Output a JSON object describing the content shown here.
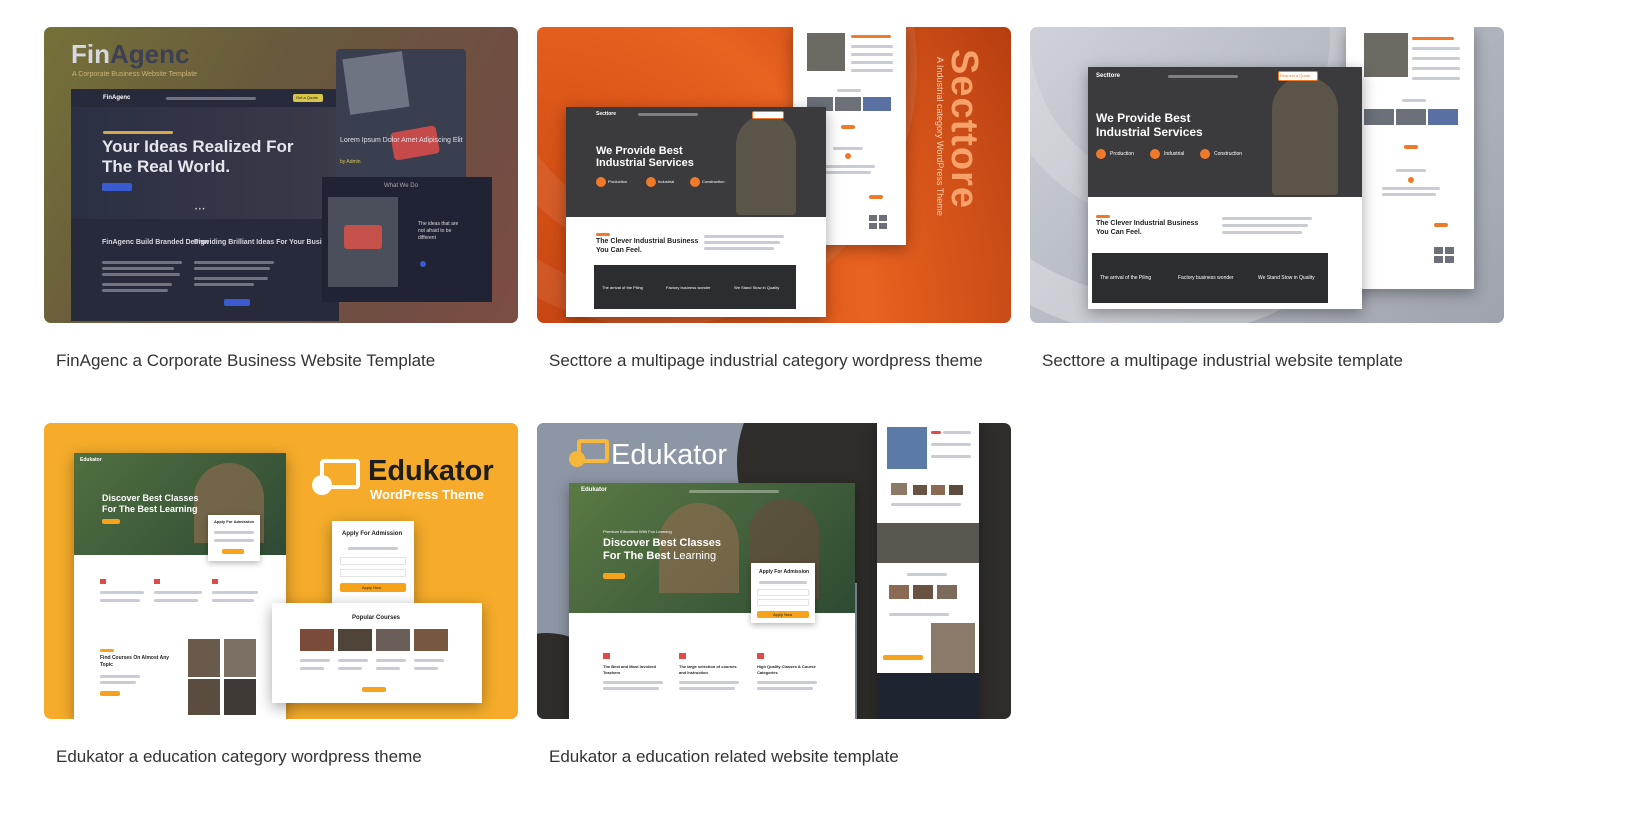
{
  "cards": [
    {
      "title": "FinAgenc a Corporate Business Website Template",
      "preview": {
        "logo_a": "Fin",
        "logo_b": "Agenc",
        "subtitle": "A Corporate Business Website Template",
        "hero_line1": "Your Ideas Realized For",
        "hero_line2": "The Real World.",
        "hero_small": "Lorem Ipsum Dolor Amet Adipiscing Elit",
        "byline": "by Admin",
        "feature1_title": "FinAgenc Build Branded Design",
        "feature2_title": "Providing Brilliant Ideas For Your Business",
        "side_heading": "What We Do",
        "side_text1": "The ideas that are",
        "side_text2": "not afraid to be",
        "side_text3": "different",
        "nav_button": "Get a Quote"
      }
    },
    {
      "title": "Secttore a multipage industrial category wordpress theme",
      "preview": {
        "brand_vertical": "Secttore",
        "tagline_vertical": "A Industrial category WordPress Theme",
        "logo": "Secttore",
        "hero_line1": "We Provide Best",
        "hero_line2": "Industrial Services",
        "chip1": "Production",
        "chip2": "Industrial",
        "chip3": "Construction",
        "about_line1": "The Clever Industrial Business",
        "about_line2": "You Can Feel.",
        "strip1": "The arrival of the Piling",
        "strip2": "Factory business wonder",
        "strip3": "We Stand Stow in Quality"
      }
    },
    {
      "title": "Secttore a multipage industrial website template",
      "preview": {
        "logo": "Secttore",
        "hero_line1": "We Provide Best",
        "hero_line2": "Industrial Services",
        "chip1": "Production",
        "chip2": "Industrial",
        "chip3": "Construction",
        "about_line1": "The Clever Industrial Business",
        "about_line2": "You Can Feel.",
        "strip1": "The arrival of the Piling",
        "strip2": "Factory business wonder",
        "strip3": "We Stand Stow in Quality",
        "nav_button": "Request a Quote"
      }
    },
    {
      "title": "Edukator a education category wordpress theme",
      "preview": {
        "logo": "Edukator",
        "logo_sub": "WordPress Theme",
        "hero_line1": "Discover Best Classes",
        "hero_line2": "For The Best Learning",
        "form_title": "Apply For Admission",
        "form_button": "Apply Now",
        "popular": "Popular Courses",
        "find_line1": "Find Courses On Almost Any",
        "find_line2": "Topic"
      }
    },
    {
      "title": "Edukator a education related website template",
      "preview": {
        "logo": "Edukator",
        "hero_small": "Premium Education With Fun Learning",
        "hero_line1": "Discover Best Classes",
        "hero_line2a": "For The Best",
        "hero_line2b": "Learning",
        "form_title": "Apply For Admission",
        "form_button": "Apply Now",
        "feature1_line1": "The Best and Most Involved",
        "feature1_line2": "Teachers",
        "feature2_line1": "The large selection of courses",
        "feature2_line2": "and Instruction",
        "feature3_line1": "High Quality Classes & Course",
        "feature3_line2": "Categories"
      }
    }
  ]
}
